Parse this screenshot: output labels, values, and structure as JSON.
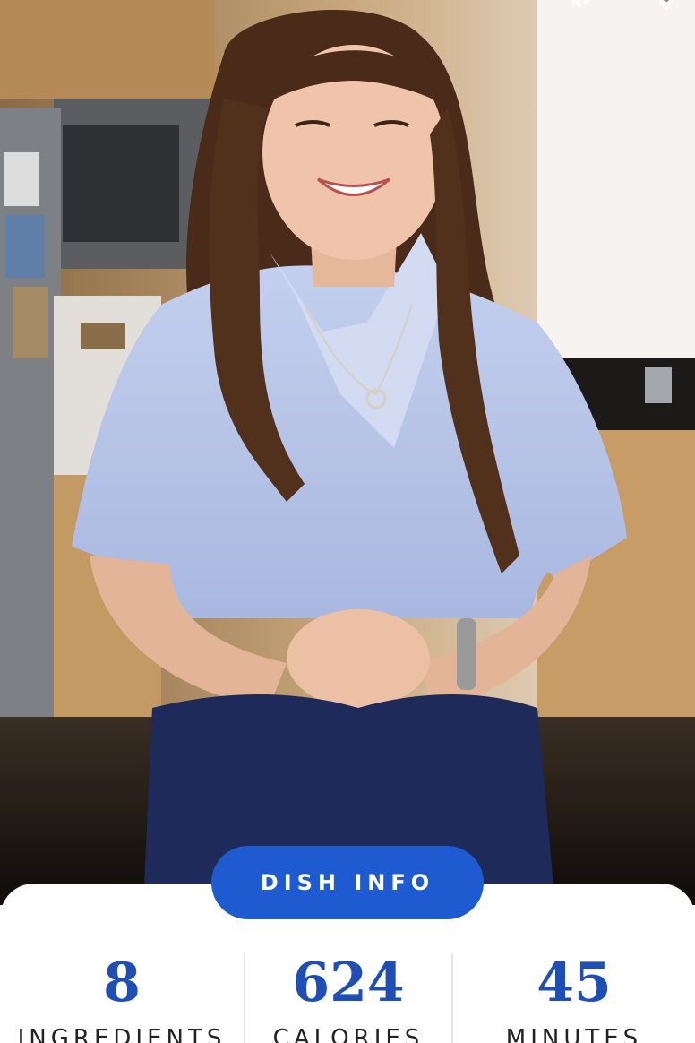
{
  "dish_info": {
    "button_label": "DISH INFO"
  },
  "stats": [
    {
      "value": "8",
      "label": "INGREDIENTS"
    },
    {
      "value": "624",
      "label": "CALORIES"
    },
    {
      "value": "45",
      "label": "MINUTES"
    }
  ],
  "icons": {
    "mute": "volume-muted-icon",
    "pin": "pin-icon"
  },
  "colors": {
    "accent": "#1f5bd0",
    "stat_value": "#1f4fb5"
  }
}
